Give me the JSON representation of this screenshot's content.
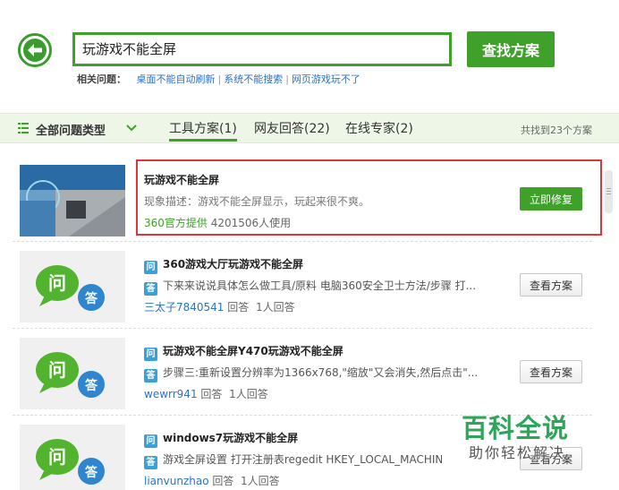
{
  "header": {
    "search_value": "玩游戏不能全屏",
    "search_button": "查找方案",
    "related_label": "相关问题：",
    "related_links": [
      "桌面不能自动刷新",
      "系统不能搜索",
      "网页游戏玩不了"
    ]
  },
  "filter_bar": {
    "all_types": "全部问题类型",
    "tabs": [
      "工具方案(1)",
      "网友回答(22)",
      "在线专家(2)"
    ],
    "count": "共找到23个方案"
  },
  "results": [
    {
      "title": "玩游戏不能全屏",
      "desc": "现象描述：游戏不能全屏显示，玩起来很不爽。",
      "provider": "360官方提供",
      "users": "4201506人使用",
      "button": "立即修复"
    },
    {
      "q_badge": "问",
      "a_badge": "答",
      "title": "360游戏大厅玩游戏不能全屏",
      "answer": "下来来说说具体怎么做工具/原料 电脑360安全卫士方法/步骤 打...",
      "user": "三太子7840541",
      "answered": "回答",
      "answers": "1人回答",
      "button": "查看方案"
    },
    {
      "q_badge": "问",
      "a_badge": "答",
      "title": "玩游戏不能全屏Y470玩游戏不能全屏",
      "answer": "步骤三:重新设置分辨率为1366x768,\"缩放\"又会消失,然后点击\"...",
      "user": "wewrr941",
      "answered": "回答",
      "answers": "1人回答",
      "button": "查看方案"
    },
    {
      "q_badge": "问",
      "a_badge": "答",
      "title": "windows7玩游戏不能全屏",
      "answer": "游戏全屏设置  打开注册表regedit  HKEY_LOCAL_MACHINE",
      "user": "lianvunzhao",
      "answered": "回答",
      "answers": "1人回答",
      "button": "查看方案"
    }
  ],
  "bubble_icon": {
    "q": "问",
    "a": "答"
  },
  "watermark": {
    "title": "百科全说",
    "subtitle": "助你轻松解决"
  },
  "colors": {
    "accent": "#3fa12a",
    "link": "#2c72c7",
    "highlight": "#d9363e"
  }
}
